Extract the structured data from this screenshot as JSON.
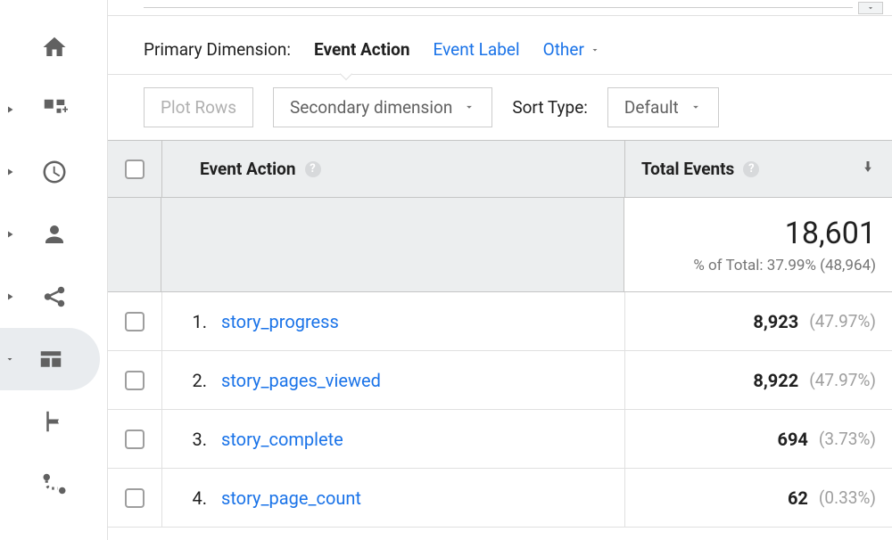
{
  "dimensions": {
    "label": "Primary Dimension:",
    "active": "Event Action",
    "link_label": "Event Label",
    "other": "Other"
  },
  "controls": {
    "plot_rows": "Plot Rows",
    "secondary_dimension": "Secondary dimension",
    "sort_type_label": "Sort Type:",
    "sort_type_value": "Default"
  },
  "table": {
    "header_action": "Event Action",
    "header_total": "Total Events",
    "summary_value": "18,601",
    "summary_sub": "% of Total: 37.99% (48,964)",
    "rows": [
      {
        "num": "1.",
        "action": "story_progress",
        "value": "8,923",
        "pct": "(47.97%)"
      },
      {
        "num": "2.",
        "action": "story_pages_viewed",
        "value": "8,922",
        "pct": "(47.97%)"
      },
      {
        "num": "3.",
        "action": "story_complete",
        "value": "694",
        "pct": "(3.73%)"
      },
      {
        "num": "4.",
        "action": "story_page_count",
        "value": "62",
        "pct": "(0.33%)"
      }
    ]
  }
}
